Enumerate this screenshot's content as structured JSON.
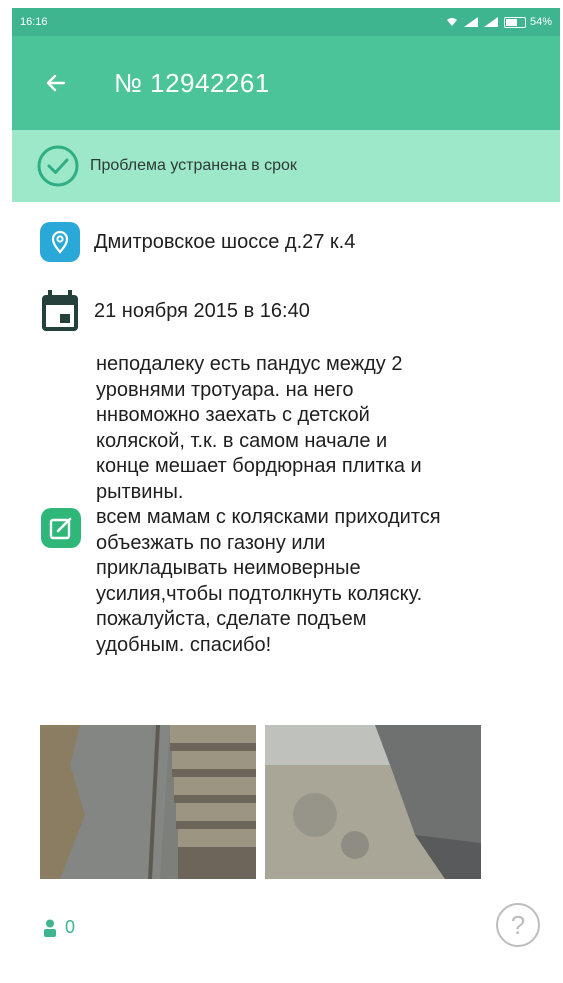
{
  "status_bar": {
    "time": "16:16",
    "battery": "54%"
  },
  "header": {
    "title": "№ 12942261"
  },
  "banner": {
    "text": "Проблема устранена в срок"
  },
  "details": {
    "address": "Дмитровское шоссе д.27 к.4",
    "date": "21 ноября 2015 в 16:40",
    "description": "неподалеку есть пандус между 2\nуровнями тротуара. на него\nннвоможно заехать с детской\nколяской, т.к. в самом начале и\nконце мешает бордюрная плитка и\nрытвины.\nвсем мамам с колясками приходится\nобъезжать по газону или\nприкладывать неимоверные\nусилия,чтобы подтолкнуть коляску.\nпожалуйста, сделате подъем\nудобным. спасибо!"
  },
  "footer": {
    "supporters_count": "0",
    "help_label": "?"
  },
  "icons": {
    "back": "arrow-left-icon",
    "resolved": "check-circle-icon",
    "location": "location-pin-icon",
    "calendar": "calendar-icon",
    "edit": "edit-icon",
    "person": "person-icon",
    "help": "question-icon"
  },
  "colors": {
    "status_bar": "#3fb58f",
    "app_bar": "#4cc49a",
    "banner": "#9ce8c9",
    "accent": "#3fb58f"
  }
}
